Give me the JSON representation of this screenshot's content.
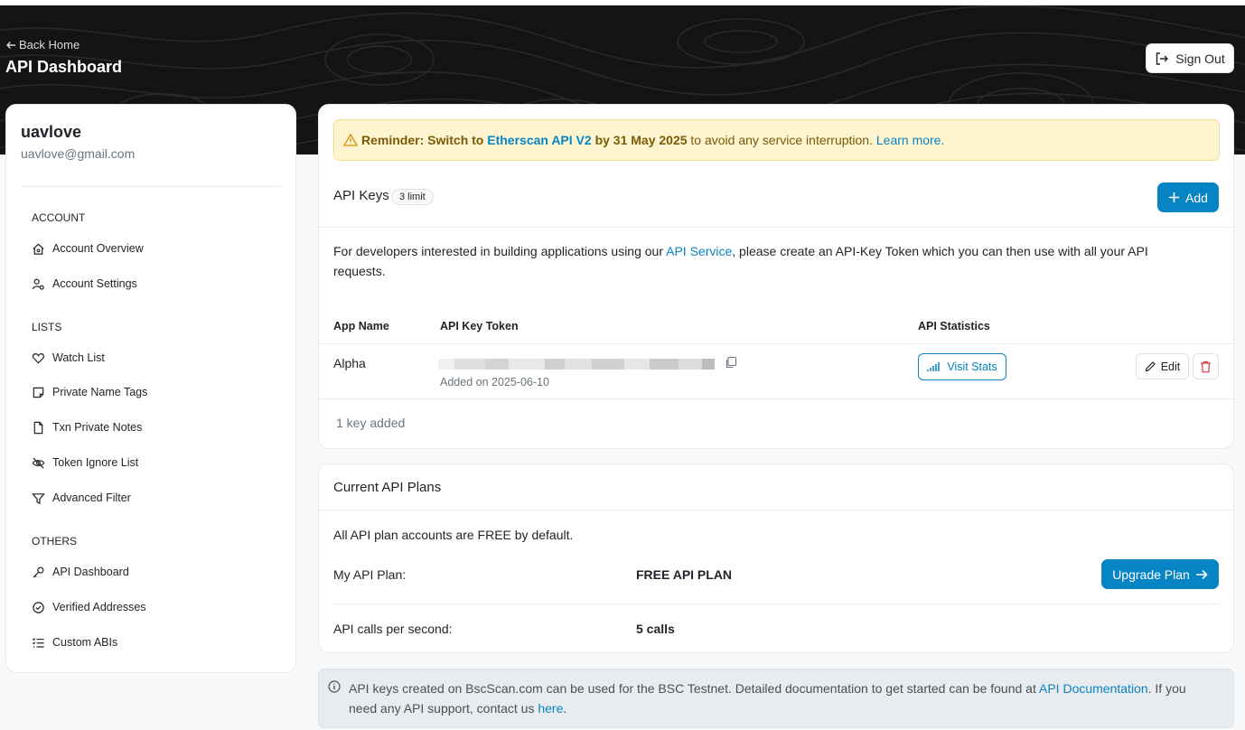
{
  "header": {
    "back_label": "Back Home",
    "title": "API Dashboard",
    "signout_label": "Sign Out"
  },
  "user": {
    "name": "uavlove",
    "email": "uavlove@gmail.com"
  },
  "sidebar": {
    "sections": [
      {
        "heading": "ACCOUNT",
        "items": [
          {
            "label": "Account Overview",
            "icon": "home-icon"
          },
          {
            "label": "Account Settings",
            "icon": "user-settings-icon"
          }
        ]
      },
      {
        "heading": "LISTS",
        "items": [
          {
            "label": "Watch List",
            "icon": "heart-icon"
          },
          {
            "label": "Private Name Tags",
            "icon": "sticky-note-icon"
          },
          {
            "label": "Txn Private Notes",
            "icon": "file-icon"
          },
          {
            "label": "Token Ignore List",
            "icon": "eye-slash-icon"
          },
          {
            "label": "Advanced Filter",
            "icon": "filter-icon"
          }
        ]
      },
      {
        "heading": "OTHERS",
        "items": [
          {
            "label": "API Dashboard",
            "icon": "key-icon"
          },
          {
            "label": "Verified Addresses",
            "icon": "check-circle-icon"
          },
          {
            "label": "Custom ABIs",
            "icon": "list-check-icon"
          }
        ]
      }
    ]
  },
  "reminder": {
    "prefix": "Reminder: Switch to",
    "link": "Etherscan API V2",
    "by_date": "by 31 May 2025",
    "suffix": "to avoid any service interruption.",
    "learn_more": "Learn more."
  },
  "api_keys": {
    "title": "API Keys",
    "limit_badge": "3 limit",
    "add_label": "Add",
    "description_pre": "For developers interested in building applications using our",
    "description_link": "API Service",
    "description_post": ", please create an API-Key Token which you can then use with all your API requests.",
    "columns": [
      "App Name",
      "API Key Token",
      "API Statistics"
    ],
    "rows": [
      {
        "app_name": "Alpha",
        "added_on": "Added on 2025-06-10",
        "stats_label": "Visit Stats",
        "edit_label": "Edit"
      }
    ],
    "count_text": "1 key added"
  },
  "plans": {
    "title": "Current API Plans",
    "free_note": "All API plan accounts are FREE by default.",
    "my_plan_label": "My API Plan:",
    "my_plan_value": "FREE API PLAN",
    "upgrade_label": "Upgrade Plan",
    "calls_label": "API calls per second:",
    "calls_value": "5 calls"
  },
  "info": {
    "text_pre": "API keys created on BscScan.com can be used for the BSC Testnet. Detailed documentation to get started can be found at",
    "doc_link": "API Documentation",
    "text_mid": ". If you need any API support, contact us",
    "here_link": "here",
    "text_end": "."
  },
  "colors": {
    "accent": "#0784c3",
    "header_bg": "#141414",
    "reminder_bg": "#fff4d0",
    "danger": "#dc3545"
  }
}
